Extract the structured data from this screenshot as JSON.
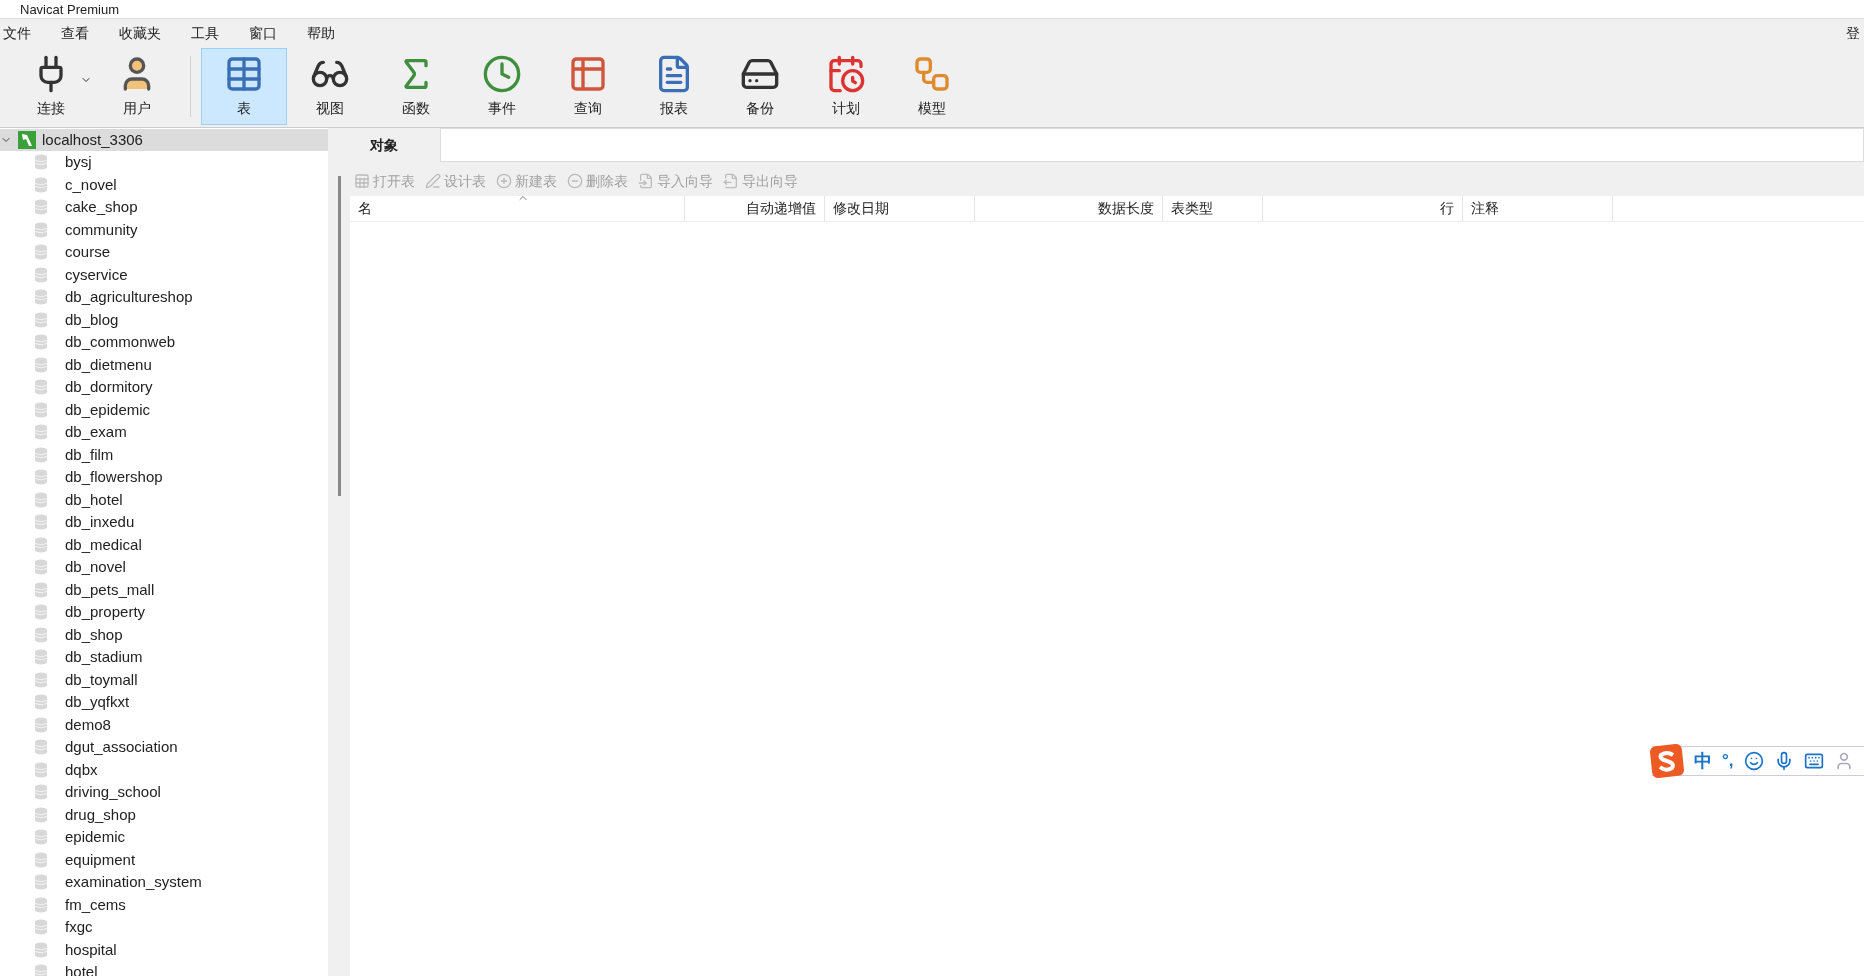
{
  "window": {
    "title": "Navicat Premium"
  },
  "menu": [
    "文件",
    "查看",
    "收藏夹",
    "工具",
    "窗口",
    "帮助"
  ],
  "login": "登",
  "toolbar": [
    {
      "kind": "connect",
      "label": "连接",
      "selected": false,
      "dropdown": true
    },
    {
      "kind": "user",
      "label": "用户",
      "selected": false,
      "dropdown": false
    },
    {
      "kind": "table",
      "label": "表",
      "selected": true,
      "dropdown": false
    },
    {
      "kind": "view",
      "label": "视图",
      "selected": false,
      "dropdown": false
    },
    {
      "kind": "function",
      "label": "函数",
      "selected": false,
      "dropdown": false
    },
    {
      "kind": "event",
      "label": "事件",
      "selected": false,
      "dropdown": false
    },
    {
      "kind": "query",
      "label": "查询",
      "selected": false,
      "dropdown": false
    },
    {
      "kind": "report",
      "label": "报表",
      "selected": false,
      "dropdown": false
    },
    {
      "kind": "backup",
      "label": "备份",
      "selected": false,
      "dropdown": false
    },
    {
      "kind": "schedule",
      "label": "计划",
      "selected": false,
      "dropdown": false
    },
    {
      "kind": "model",
      "label": "模型",
      "selected": false,
      "dropdown": false
    }
  ],
  "sidebar": {
    "tree": [
      {
        "label": "localhost_3306",
        "expanded": true,
        "selected": true,
        "children": [
          {
            "label": "bysj",
            "selected": false
          },
          {
            "label": "c_novel",
            "selected": false
          },
          {
            "label": "cake_shop",
            "selected": false
          },
          {
            "label": "community",
            "selected": false
          },
          {
            "label": "course",
            "selected": false
          },
          {
            "label": "cyservice",
            "selected": false
          },
          {
            "label": "db_agricultureshop",
            "selected": false
          },
          {
            "label": "db_blog",
            "selected": false
          },
          {
            "label": "db_commonweb",
            "selected": false
          },
          {
            "label": "db_dietmenu",
            "selected": false
          },
          {
            "label": "db_dormitory",
            "selected": false
          },
          {
            "label": "db_epidemic",
            "selected": false
          },
          {
            "label": "db_exam",
            "selected": false
          },
          {
            "label": "db_film",
            "selected": false
          },
          {
            "label": "db_flowershop",
            "selected": false
          },
          {
            "label": "db_hotel",
            "selected": false
          },
          {
            "label": "db_inxedu",
            "selected": false
          },
          {
            "label": "db_medical",
            "selected": false
          },
          {
            "label": "db_novel",
            "selected": false
          },
          {
            "label": "db_pets_mall",
            "selected": false
          },
          {
            "label": "db_property",
            "selected": false
          },
          {
            "label": "db_shop",
            "selected": false
          },
          {
            "label": "db_stadium",
            "selected": false
          },
          {
            "label": "db_toymall",
            "selected": false
          },
          {
            "label": "db_yqfkxt",
            "selected": false
          },
          {
            "label": "demo8",
            "selected": false
          },
          {
            "label": "dgut_association",
            "selected": false
          },
          {
            "label": "dqbx",
            "selected": false
          },
          {
            "label": "driving_school",
            "selected": false
          },
          {
            "label": "drug_shop",
            "selected": false
          },
          {
            "label": "epidemic",
            "selected": false
          },
          {
            "label": "equipment",
            "selected": false
          },
          {
            "label": "examination_system",
            "selected": false
          },
          {
            "label": "fm_cems",
            "selected": false
          },
          {
            "label": "fxgc",
            "selected": false
          },
          {
            "label": "hospital",
            "selected": false
          },
          {
            "label": "hotel",
            "selected": false
          }
        ]
      }
    ]
  },
  "tabs": [
    {
      "label": "对象",
      "selected": true
    }
  ],
  "object_toolbar": [
    {
      "kind": "open",
      "label": "打开表",
      "disabled": true
    },
    {
      "kind": "design",
      "label": "设计表",
      "disabled": true
    },
    {
      "kind": "new",
      "label": "新建表",
      "disabled": true
    },
    {
      "kind": "delete",
      "label": "删除表",
      "disabled": true
    },
    {
      "kind": "import",
      "label": "导入向导",
      "disabled": true
    },
    {
      "kind": "export",
      "label": "导出向导",
      "disabled": true
    }
  ],
  "table": {
    "columns": [
      {
        "label": "名",
        "kind": "text",
        "sorted": true
      },
      {
        "label": "自动递增值",
        "kind": "number",
        "sorted": false
      },
      {
        "label": "修改日期",
        "kind": "text",
        "sorted": false
      },
      {
        "label": "数据长度",
        "kind": "number",
        "sorted": false
      },
      {
        "label": "表类型",
        "kind": "text",
        "sorted": false
      },
      {
        "label": "行",
        "kind": "number",
        "sorted": false
      },
      {
        "label": "注释",
        "kind": "text",
        "sorted": false
      }
    ]
  },
  "ime_bar": {
    "mode": "中",
    "punctuation": "°,"
  }
}
